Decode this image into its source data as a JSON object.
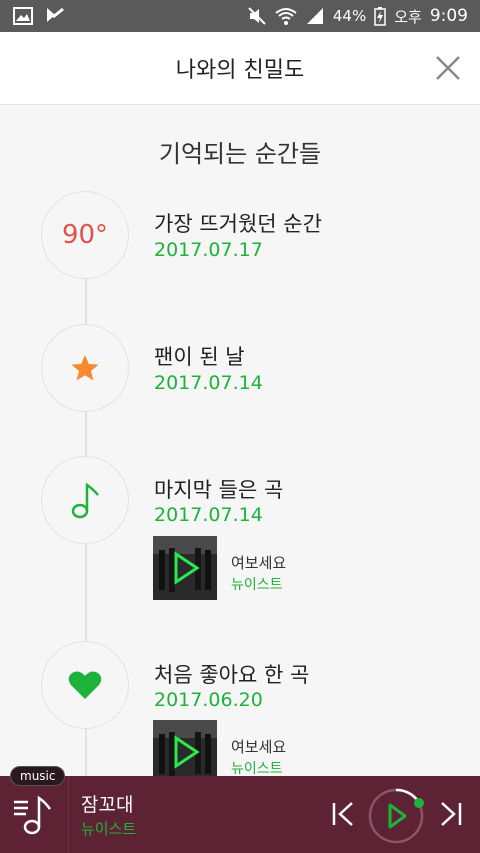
{
  "status_bar": {
    "battery": "44%",
    "ampm": "오후",
    "time": "9:09"
  },
  "header": {
    "title": "나와의 친밀도"
  },
  "section_title": "기억되는 순간들",
  "moments": [
    {
      "title": "가장 뜨거웠던 순간",
      "date": "2017.07.17",
      "badge_text": "90°",
      "icon": "temperature-badge"
    },
    {
      "title": "팬이 된 날",
      "date": "2017.07.14",
      "icon": "star-icon"
    },
    {
      "title": "마지막 들은 곡",
      "date": "2017.07.14",
      "icon": "music-note-icon",
      "song": {
        "name": "여보세요",
        "artist": "뉴이스트"
      }
    },
    {
      "title": "처음 좋아요 한 곡",
      "date": "2017.06.20",
      "icon": "heart-icon",
      "song": {
        "name": "여보세요",
        "artist": "뉴이스트"
      }
    }
  ],
  "player": {
    "tag": "music",
    "song": "잠꼬대",
    "artist": "뉴이스트"
  },
  "colors": {
    "accent_green": "#1db33b",
    "player_bg": "#5d2233",
    "temp_red": "#e0524a",
    "star_orange": "#f68a2c"
  }
}
